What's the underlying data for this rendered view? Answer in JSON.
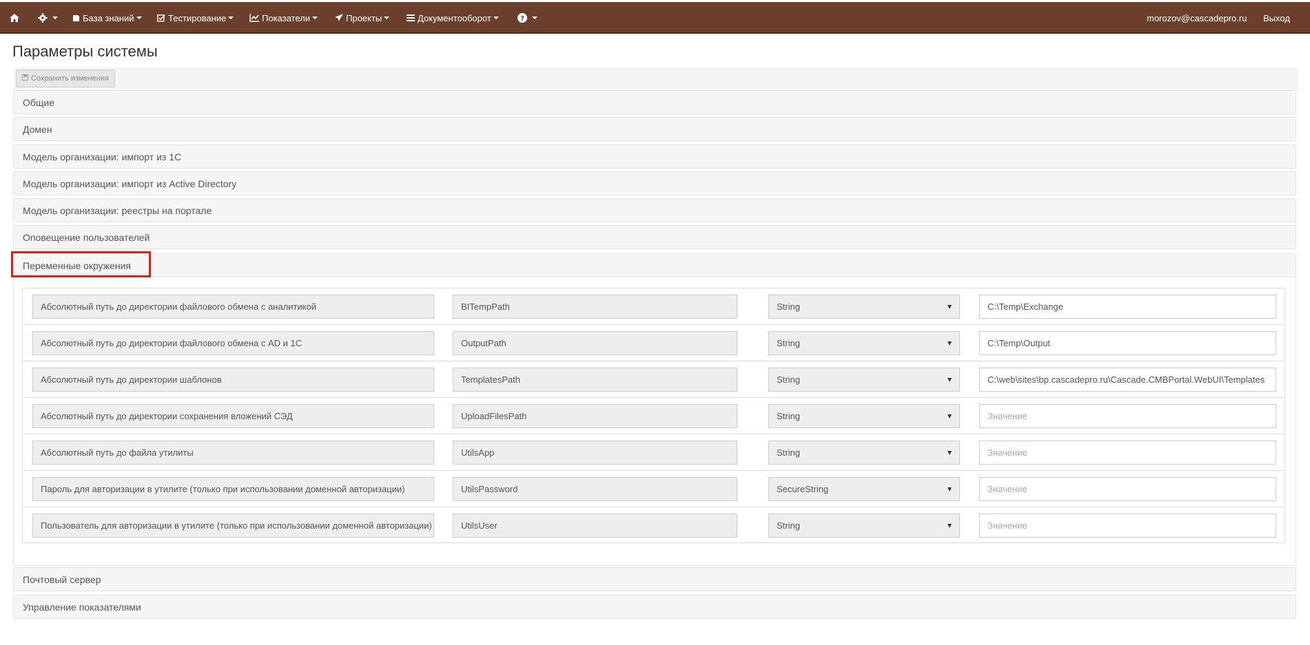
{
  "nav": {
    "home_icon": "home-icon",
    "settings_icon": "gear-icon",
    "menus": [
      {
        "label": "База знаний",
        "icon": "book-icon"
      },
      {
        "label": "Тестирование",
        "icon": "checkbox-icon"
      },
      {
        "label": "Показатели",
        "icon": "line-chart-icon"
      },
      {
        "label": "Проекты",
        "icon": "paper-plane-icon"
      },
      {
        "label": "Документооборот",
        "icon": "list-icon"
      }
    ],
    "help_icon": "question-circle-icon",
    "user": "morozov@cascadepro.ru",
    "logout": "Выход"
  },
  "page": {
    "title": "Параметры системы",
    "save_label": "Сохранить изменения"
  },
  "sections": [
    "Общие",
    "Домен",
    "Модель организации: импорт из 1С",
    "Модель организации: импорт из Active Directory",
    "Модель организации: реестры на портале",
    "Оповещение пользователей",
    "Переменные окружения",
    "Почтовый сервер",
    "Управление показателями"
  ],
  "variables": [
    {
      "desc": "Абсолютный путь до директории файлового обмена с аналитикой",
      "key": "BITempPath",
      "type": "String",
      "value": "C:\\Temp\\Exchange"
    },
    {
      "desc": "Абсолютный путь до директории файлового обмена с AD и 1C",
      "key": "OutputPath",
      "type": "String",
      "value": "C:\\Temp\\Output"
    },
    {
      "desc": "Абсолютный путь до директории шаблонов",
      "key": "TemplatesPath",
      "type": "String",
      "value": "C:\\web\\sites\\bp.cascadepro.ru\\Cascade.CMBPortal.WebUI\\Templates"
    },
    {
      "desc": "Абсолютный путь до директории сохранения вложений СЭД",
      "key": "UploadFilesPath",
      "type": "String",
      "value": ""
    },
    {
      "desc": "Абсолютный путь до файла утилиты",
      "key": "UtilsApp",
      "type": "String",
      "value": ""
    },
    {
      "desc": "Пароль для авторизации в утилите (только при использовании доменной авторизации)",
      "key": "UtilsPassword",
      "type": "SecureString",
      "value": ""
    },
    {
      "desc": "Пользователь для авторизации в утилите (только при использовании доменной авторизации)",
      "key": "UtilsUser",
      "type": "String",
      "value": ""
    }
  ],
  "value_placeholder": "Значение"
}
